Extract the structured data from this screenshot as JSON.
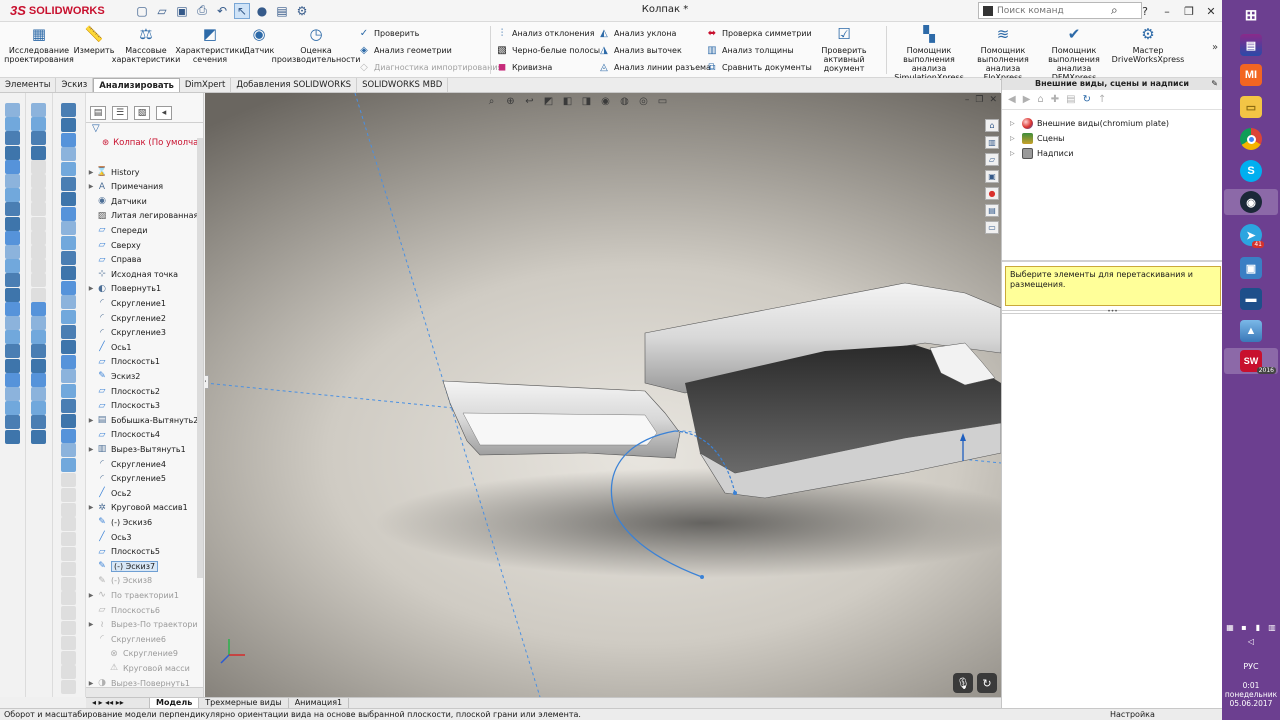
{
  "app": {
    "brand": "SOLIDWORKS",
    "document_title": "Колпак *"
  },
  "search": {
    "placeholder": "Поиск команд"
  },
  "ribbon": {
    "big": [
      {
        "label": "Исследование проектирования",
        "icon": "design-study-icon"
      },
      {
        "label": "Измерить",
        "icon": "measure-icon"
      },
      {
        "label": "Массовые характеристики",
        "icon": "mass-properties-icon"
      },
      {
        "label": "Характеристики сечения",
        "icon": "section-properties-icon"
      },
      {
        "label": "Датчик",
        "icon": "sensor-icon"
      },
      {
        "label": "Оценка производительности",
        "icon": "performance-evaluation-icon"
      }
    ],
    "col1": [
      {
        "label": "Проверить",
        "disabled": false
      },
      {
        "label": "Анализ геометрии",
        "disabled": false
      },
      {
        "label": "Диагностика импортирования",
        "disabled": true
      }
    ],
    "col2": [
      {
        "label": "Анализ отклонения"
      },
      {
        "label": "Черно-белые полосы"
      },
      {
        "label": "Кривизна"
      }
    ],
    "col3": [
      {
        "label": "Анализ уклона"
      },
      {
        "label": "Анализ выточек"
      },
      {
        "label": "Анализ линии разъема"
      }
    ],
    "col4": [
      {
        "label": "Проверка симметрии"
      },
      {
        "label": "Анализ толщины"
      },
      {
        "label": "Сравнить документы"
      }
    ],
    "check_active": "Проверить активный документ",
    "assistants": [
      {
        "label": "Помощник выполнения анализа SimulationXpress"
      },
      {
        "label": "Помощник выполнения анализа FloXpress"
      },
      {
        "label": "Помощник выполнения анализа DFMXpress"
      },
      {
        "label": "Мастер DriveWorksXpress"
      }
    ]
  },
  "tabs": [
    "Элементы",
    "Эскиз",
    "Анализировать",
    "DimXpert",
    "Добавления SOLIDWORKS",
    "SOLIDWORKS MBD"
  ],
  "active_tab": "Анализировать",
  "tree": {
    "root": "Колпак  (По умолча",
    "nodes": [
      {
        "label": "History",
        "icon": "history-icon",
        "state": "normal",
        "expand": true
      },
      {
        "label": "Примечания",
        "icon": "annotations-icon",
        "state": "normal",
        "expand": true
      },
      {
        "label": "Датчики",
        "icon": "sensors-icon",
        "state": "normal",
        "expand": false
      },
      {
        "label": "Литая легированная",
        "icon": "material-icon",
        "state": "normal",
        "expand": false
      },
      {
        "label": "Спереди",
        "icon": "plane-icon",
        "state": "normal",
        "expand": false
      },
      {
        "label": "Сверху",
        "icon": "plane-icon",
        "state": "normal",
        "expand": false
      },
      {
        "label": "Справа",
        "icon": "plane-icon",
        "state": "normal",
        "expand": false
      },
      {
        "label": "Исходная точка",
        "icon": "origin-icon",
        "state": "normal",
        "expand": false
      },
      {
        "label": "Повернуть1",
        "icon": "revolve-icon",
        "state": "normal",
        "expand": true
      },
      {
        "label": "Скругление1",
        "icon": "fillet-icon",
        "state": "normal",
        "expand": false
      },
      {
        "label": "Скругление2",
        "icon": "fillet-icon",
        "state": "normal",
        "expand": false
      },
      {
        "label": "Скругление3",
        "icon": "fillet-icon",
        "state": "normal",
        "expand": false
      },
      {
        "label": "Ось1",
        "icon": "axis-icon",
        "state": "normal",
        "expand": false
      },
      {
        "label": "Плоскость1",
        "icon": "plane-icon",
        "state": "normal",
        "expand": false
      },
      {
        "label": "Эскиз2",
        "icon": "sketch-icon",
        "state": "normal",
        "expand": false
      },
      {
        "label": "Плоскость2",
        "icon": "plane-icon",
        "state": "normal",
        "expand": false
      },
      {
        "label": "Плоскость3",
        "icon": "plane-icon",
        "state": "normal",
        "expand": false
      },
      {
        "label": "Бобышка-Вытянуть2",
        "icon": "extrude-icon",
        "state": "normal",
        "expand": true
      },
      {
        "label": "Плоскость4",
        "icon": "plane-icon",
        "state": "normal",
        "expand": false
      },
      {
        "label": "Вырез-Вытянуть1",
        "icon": "cut-extrude-icon",
        "state": "normal",
        "expand": true
      },
      {
        "label": "Скругление4",
        "icon": "fillet-icon",
        "state": "normal",
        "expand": false
      },
      {
        "label": "Скругление5",
        "icon": "fillet-icon",
        "state": "normal",
        "expand": false
      },
      {
        "label": "Ось2",
        "icon": "axis-icon",
        "state": "normal",
        "expand": false
      },
      {
        "label": "Круговой массив1",
        "icon": "circular-pattern-icon",
        "state": "normal",
        "expand": true
      },
      {
        "label": "(-) Эскиз6",
        "icon": "sketch-icon",
        "state": "normal",
        "expand": false
      },
      {
        "label": "Ось3",
        "icon": "axis-icon",
        "state": "normal",
        "expand": false
      },
      {
        "label": "Плоскость5",
        "icon": "plane-icon",
        "state": "normal",
        "expand": false
      },
      {
        "label": "(-) Эскиз7",
        "icon": "sketch-icon",
        "state": "selected",
        "expand": false
      },
      {
        "label": "(-) Эскиз8",
        "icon": "sketch-icon",
        "state": "sup",
        "expand": false
      },
      {
        "label": "По траектории1",
        "icon": "sweep-icon",
        "state": "sup",
        "expand": true
      },
      {
        "label": "Плоскость6",
        "icon": "plane-icon",
        "state": "sup",
        "expand": false
      },
      {
        "label": "Вырез-По траектори",
        "icon": "cut-sweep-icon",
        "state": "sup",
        "expand": true
      },
      {
        "label": "Скругление6",
        "icon": "fillet-icon",
        "state": "sup",
        "expand": false
      },
      {
        "label": "Скругление9",
        "icon": "error-icon",
        "state": "sup",
        "expand": false,
        "indent": true
      },
      {
        "label": "Круговой масси",
        "icon": "warning-icon",
        "state": "sup",
        "expand": false,
        "indent": true
      },
      {
        "label": "Вырез-Повернуть1",
        "icon": "cut-revolve-icon",
        "state": "sup",
        "expand": true
      }
    ]
  },
  "bottom_tabs": [
    "Модель",
    "Трехмерные виды",
    "Анимация1"
  ],
  "taskpane": {
    "title": "Внешние виды, сцены и надписи",
    "items": [
      {
        "label": "Внешние виды(chromium plate)",
        "color": "#d9302c"
      },
      {
        "label": "Сцены",
        "color": "#3d8d3d"
      },
      {
        "label": "Надписи",
        "color": "#7a7a7a"
      }
    ],
    "note": "Выберите элементы для перетаскивания и размещения."
  },
  "status": {
    "left": "Оборот и масштабирование модели перпендикулярно ориентации вида на основе выбранной плоскости, плоской грани или элемента.",
    "right": "Настройка"
  },
  "taskbar": {
    "language": "РУС",
    "time": "0:01",
    "weekday": "понедельник",
    "date": "05.06.2017",
    "telegram_badge": "41",
    "sw_badge": "2016"
  },
  "colors": {
    "brand": "#c8102e",
    "taskbar": "#6c3f90",
    "note_bg": "#ffff99"
  }
}
